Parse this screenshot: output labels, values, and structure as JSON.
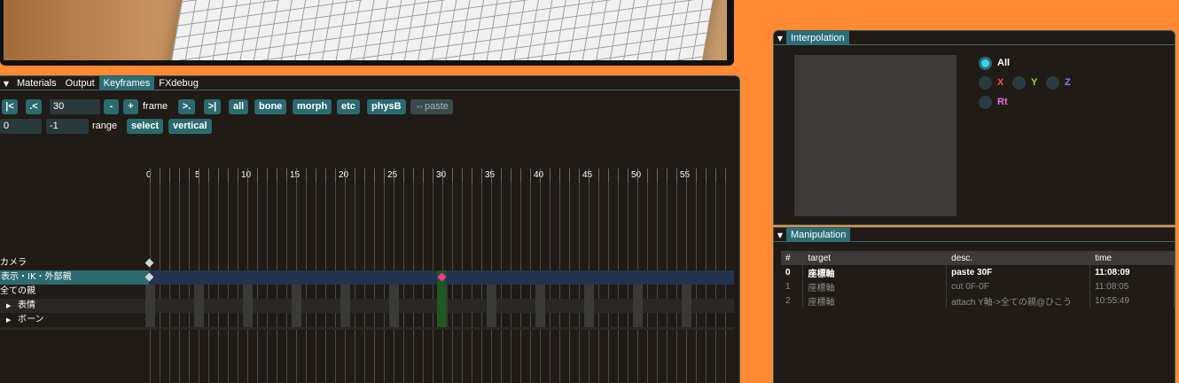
{
  "keyframes": {
    "tabs": [
      "Materials",
      "Output",
      "Keyframes",
      "FXdebug"
    ],
    "active_tab": "Keyframes",
    "toolbar": {
      "first_btn": "|<",
      "prev_btn": ".<",
      "frame_value": "30",
      "minus_btn": "-",
      "plus_btn": "+",
      "frame_label": "frame",
      "next_btn": ">.",
      "last_btn": ">|",
      "all_btn": "all",
      "bone_btn": "bone",
      "morph_btn": "morph",
      "etc_btn": "etc",
      "physb_btn": "physB",
      "paste_btn": "⇔paste",
      "range_start": "0",
      "range_end": "-1",
      "range_label": "range",
      "select_btn": "select",
      "vertical_btn": "vertical"
    },
    "ruler_numbers": [
      "0",
      "5",
      "10",
      "15",
      "20",
      "25",
      "30",
      "35",
      "40",
      "45",
      "50",
      "55"
    ],
    "current_frame": 30,
    "rows": [
      {
        "label": "カメラ",
        "expandable": false,
        "selected": false
      },
      {
        "label": "表示・IK・外部親",
        "expandable": false,
        "selected": true
      },
      {
        "label": "全ての親",
        "expandable": false,
        "selected": false
      },
      {
        "label": "表情",
        "expandable": true,
        "selected": false
      },
      {
        "label": "ボーン",
        "expandable": true,
        "selected": false
      }
    ]
  },
  "interpolation": {
    "title": "Interpolation",
    "options": {
      "all": "All",
      "x": "X",
      "y": "Y",
      "z": "Z",
      "rt": "Rt"
    },
    "selected": "All",
    "colors": {
      "all": "#ffffff",
      "x": "#ff4b4b",
      "y": "#7fe03c",
      "z": "#8a7cff",
      "rt": "#ee6ee0"
    }
  },
  "manipulation": {
    "title": "Manipulation",
    "columns": [
      "#",
      "target",
      "desc.",
      "time"
    ],
    "rows": [
      [
        "0",
        "座標軸",
        "paste 30F",
        "11:08:09"
      ],
      [
        "1",
        "座標軸",
        "cut 0F-0F",
        "11:08:05"
      ],
      [
        "2",
        "座標軸",
        "attach Y軸->全ての親@ひこう",
        "10:55:49"
      ]
    ]
  }
}
